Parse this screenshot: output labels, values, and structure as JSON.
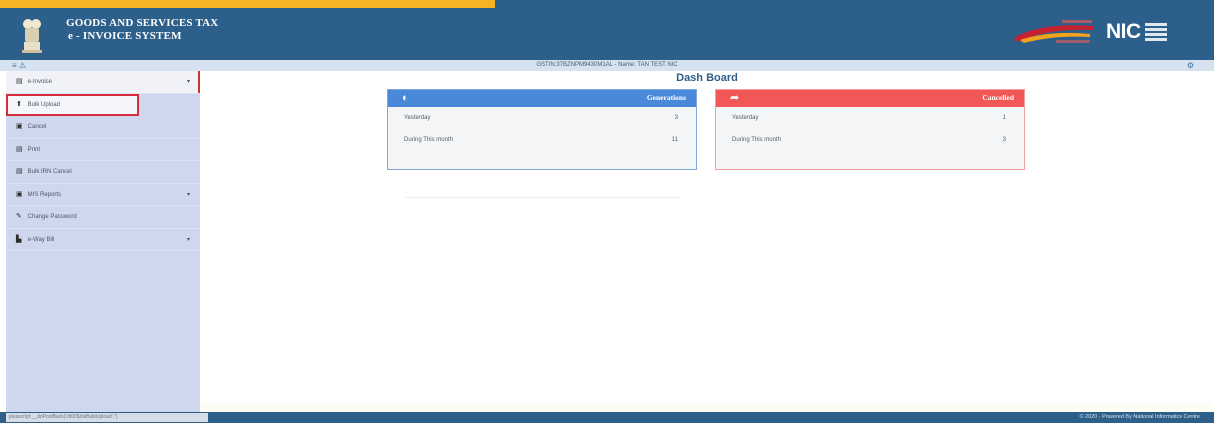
{
  "header": {
    "title_line1": "GOODS AND SERVICES TAX",
    "title_line2": "e - INVOICE SYSTEM",
    "nic_logo": "NIC",
    "colors": {
      "header_bg": "#2d5f8b",
      "accent": "#f4b424"
    }
  },
  "infobar": {
    "quick_icons": "≡ ⚠",
    "user_info": "GSTIN:37BZNPM9430M1AL - Name: TAN TEST NIC",
    "settings_icon": "⚙"
  },
  "sidebar": {
    "items": [
      {
        "icon": "file-icon",
        "glyph": "▤",
        "label": "e-Invoice",
        "caret": "▾"
      },
      {
        "icon": "upload-icon",
        "glyph": "⬆",
        "label": "Bulk Upload",
        "caret": ""
      },
      {
        "icon": "cancel-icon",
        "glyph": "▣",
        "label": "Cancel",
        "caret": ""
      },
      {
        "icon": "print-icon",
        "glyph": "▤",
        "label": "Print",
        "caret": ""
      },
      {
        "icon": "print-icon",
        "glyph": "▤",
        "label": "Bulk IRN Cancel",
        "caret": ""
      },
      {
        "icon": "report-icon",
        "glyph": "▣",
        "label": "MIS Reports",
        "caret": "▾"
      },
      {
        "icon": "key-icon",
        "glyph": "✎",
        "label": "Change Password",
        "caret": ""
      },
      {
        "icon": "truck-icon",
        "glyph": "▙",
        "label": "e-Way Bill",
        "caret": "▾"
      }
    ]
  },
  "dashboard": {
    "title": "Dash Board",
    "generations": {
      "icon": "adjust-icon",
      "glyph": "◐",
      "title": "Generations",
      "rows": [
        {
          "label": "Yesterday",
          "value": "3"
        },
        {
          "label": "During This month",
          "value": "11"
        }
      ]
    },
    "cancelled": {
      "icon": "share-icon",
      "glyph": "➦",
      "title": "Cancelled",
      "rows": [
        {
          "label": "Yesterday",
          "value": "1"
        },
        {
          "label": "During This month",
          "value": "3"
        }
      ]
    }
  },
  "footer": {
    "status": "javascript:__doPostBack('ctl00$lnkBulkUpload','')",
    "copyright": "© 2020 - Powered By National Informatics Centre"
  }
}
